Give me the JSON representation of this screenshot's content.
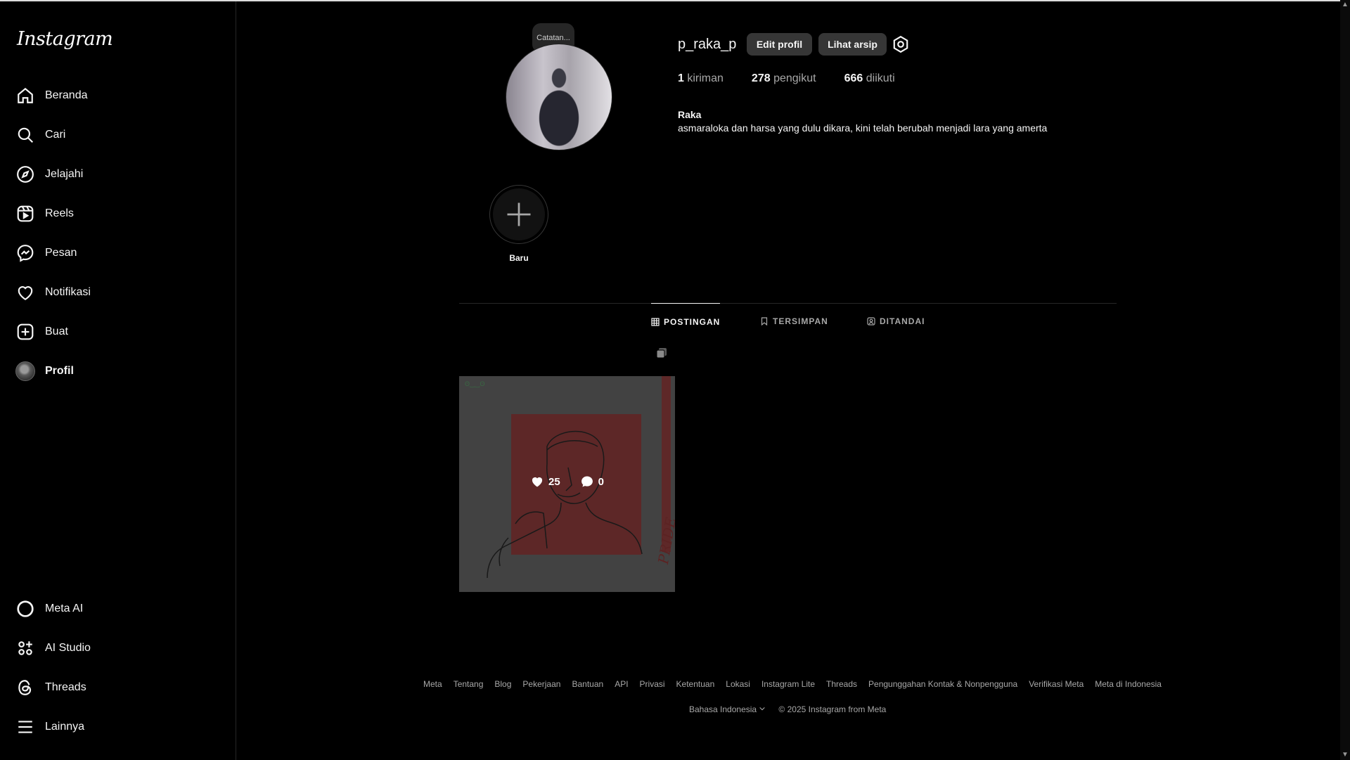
{
  "sidebar": {
    "logo": "Instagram",
    "items": [
      {
        "label": "Beranda",
        "icon": "home-icon"
      },
      {
        "label": "Cari",
        "icon": "search-icon"
      },
      {
        "label": "Jelajahi",
        "icon": "compass-icon"
      },
      {
        "label": "Reels",
        "icon": "reels-icon"
      },
      {
        "label": "Pesan",
        "icon": "messenger-icon"
      },
      {
        "label": "Notifikasi",
        "icon": "heart-icon"
      },
      {
        "label": "Buat",
        "icon": "plus-square-icon"
      },
      {
        "label": "Profil",
        "icon": "avatar"
      }
    ],
    "bottom_items": [
      {
        "label": "Meta AI",
        "icon": "meta-ai-icon"
      },
      {
        "label": "AI Studio",
        "icon": "ai-studio-icon"
      },
      {
        "label": "Threads",
        "icon": "threads-icon"
      },
      {
        "label": "Lainnya",
        "icon": "menu-icon"
      }
    ]
  },
  "profile": {
    "note": "Catatan...",
    "username": "p_raka_p",
    "edit_button": "Edit profil",
    "archive_button": "Lihat arsip",
    "stats": {
      "posts_count": "1",
      "posts_label": "kiriman",
      "followers_count": "278",
      "followers_label": "pengikut",
      "following_count": "666",
      "following_label": "diikuti"
    },
    "full_name": "Raka",
    "bio": "asmaraloka dan harsa yang dulu dikara, kini telah berubah menjadi lara yang amerta"
  },
  "highlight": {
    "label": "Baru"
  },
  "tabs": [
    {
      "label": "POSTINGAN",
      "icon": "grid-icon",
      "active": true
    },
    {
      "label": "TERSIMPAN",
      "icon": "bookmark-icon",
      "active": false
    },
    {
      "label": "DITANDAI",
      "icon": "tagged-icon",
      "active": false
    }
  ],
  "post": {
    "likes": "25",
    "comments": "0",
    "caption_art_text": "PRIDE"
  },
  "footer": {
    "links": [
      "Meta",
      "Tentang",
      "Blog",
      "Pekerjaan",
      "Bantuan",
      "API",
      "Privasi",
      "Ketentuan",
      "Lokasi",
      "Instagram Lite",
      "Threads",
      "Pengunggahan Kontak & Nonpengguna",
      "Verifikasi Meta",
      "Meta di Indonesia"
    ],
    "language": "Bahasa Indonesia",
    "copyright": "© 2025 Instagram from Meta"
  },
  "colors": {
    "background": "#000000",
    "button": "#363636",
    "muted_text": "#a8a8a8"
  }
}
